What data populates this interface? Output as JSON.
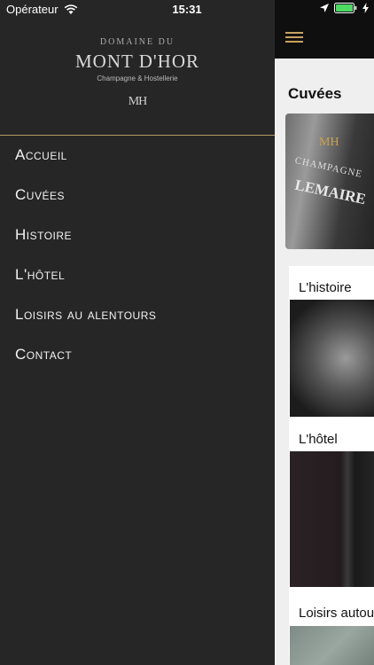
{
  "status": {
    "carrier": "Opérateur",
    "time": "15:31"
  },
  "drawer": {
    "brand_pre": "DOMAINE DU",
    "brand_title": "MONT D'HOR",
    "brand_sub": "Champagne & Hostellerie",
    "brand_mark": "MH",
    "menu": [
      "Accueil",
      "Cuvées",
      "Histoire",
      "L'hôtel",
      "Loisirs au alentours",
      "Contact"
    ]
  },
  "main": {
    "title": "Cuvées",
    "bottle_label_line1": "CHAMPAGNE",
    "bottle_label_line2": "LEMAIRE",
    "bottle_mark": "MH",
    "cards": [
      "L'histoire",
      "L'hôtel",
      "Loisirs autou"
    ]
  },
  "colors": {
    "accent": "#b39a62",
    "drawer_bg": "#262626",
    "topbar_bg": "#0f0f0f"
  }
}
